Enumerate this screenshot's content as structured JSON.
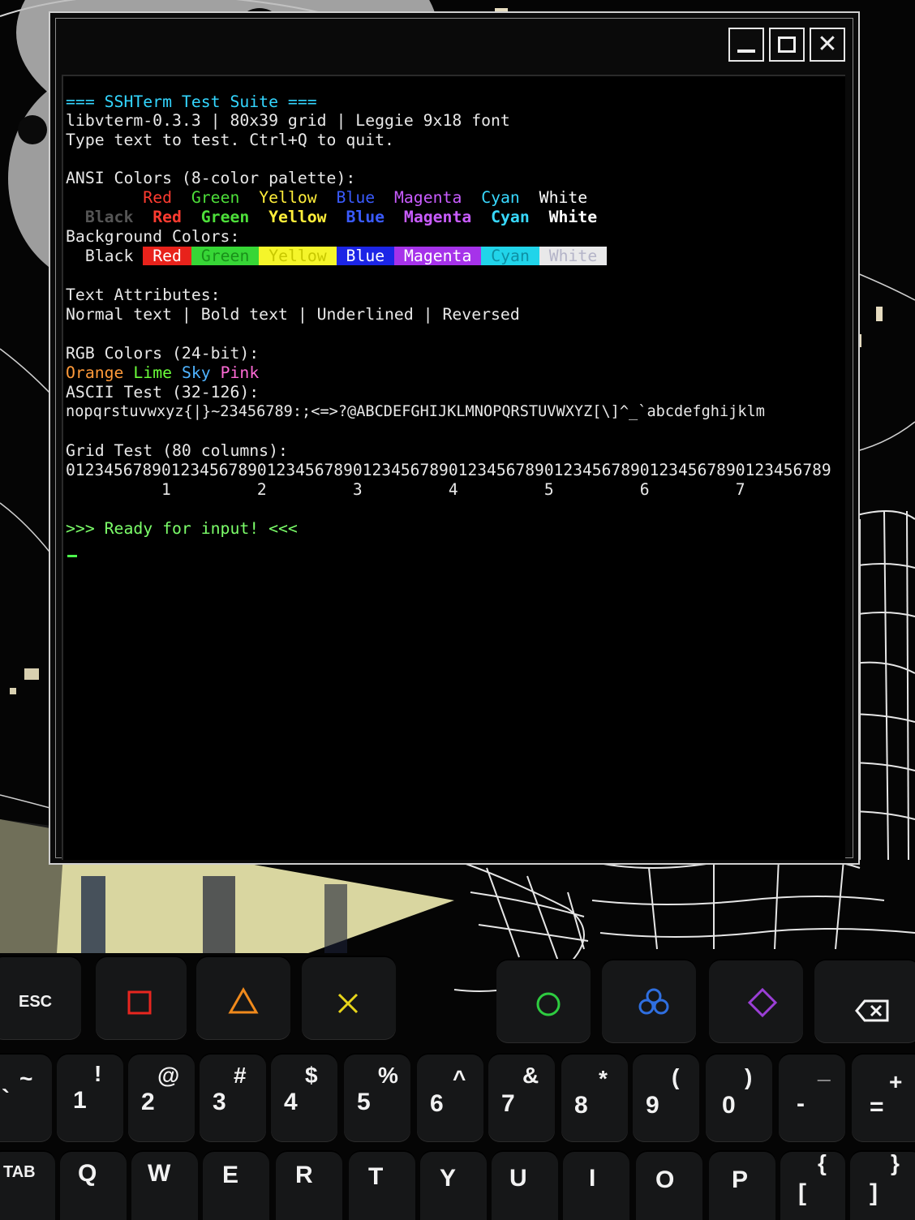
{
  "window": {
    "minimize_label": "_",
    "maximize_label": "□",
    "close_label": "✕"
  },
  "terminal": {
    "lines": {
      "title": "=== SSHTerm Test Suite ===",
      "info": "libvterm-0.3.3 | 80x39 grid | Leggie 9x18 font",
      "instructions": "Type text to test. Ctrl+Q to quit.",
      "ansi_heading": "ANSI Colors (8-color palette):",
      "bg_heading": "Background Colors:",
      "attr_heading": "Text Attributes:",
      "attr_line": "Normal text | Bold text | Underlined | Reversed",
      "rgb_heading": "RGB Colors (24-bit):",
      "ascii_heading": "ASCII Test (32-126):",
      "ascii_line": "nopqrstuvwxyz{|}~23456789:;<=>?@ABCDEFGHIJKLMNOPQRSTUVWXYZ[\\]^_`abcdefghijklm",
      "grid_heading": "Grid Test (80 columns):",
      "grid_digits": "01234567890123456789012345678901234567890123456789012345678901234567890123456789",
      "grid_markers": "          1         2         3         4         5         6         7",
      "ready": ">>> Ready for input! <<<"
    },
    "ansi_row1": [
      "Red",
      "Green",
      "Yellow",
      "Blue",
      "Magenta",
      "Cyan",
      "White"
    ],
    "ansi_row2": [
      "Black",
      "Red",
      "Green",
      "Yellow",
      "Blue",
      "Magenta",
      "Cyan",
      "White"
    ],
    "bg_row": [
      "Black",
      "Red",
      "Green",
      "Yellow",
      "Blue",
      "Magenta",
      "Cyan",
      "White"
    ],
    "rgb_row": [
      "Orange",
      "Lime",
      "Sky",
      "Pink"
    ]
  },
  "keyboard": {
    "row1": [
      "ESC",
      "square",
      "triangle",
      "cross",
      "circle",
      "clover",
      "diamond",
      "backspace"
    ],
    "row2": [
      {
        "main": "`",
        "shift": "~"
      },
      {
        "main": "1",
        "shift": "!"
      },
      {
        "main": "2",
        "shift": "@"
      },
      {
        "main": "3",
        "shift": "#"
      },
      {
        "main": "4",
        "shift": "$"
      },
      {
        "main": "5",
        "shift": "%"
      },
      {
        "main": "6",
        "shift": "^"
      },
      {
        "main": "7",
        "shift": "&"
      },
      {
        "main": "8",
        "shift": "*"
      },
      {
        "main": "9",
        "shift": "("
      },
      {
        "main": "0",
        "shift": ")"
      },
      {
        "main": "-",
        "shift": "_"
      },
      {
        "main": "=",
        "shift": "+"
      }
    ],
    "row3": [
      "TAB",
      "Q",
      "W",
      "E",
      "R",
      "T",
      "Y",
      "U",
      "I",
      "O",
      "P",
      "[",
      "]"
    ],
    "row3_shift": [
      "{",
      "}"
    ]
  },
  "colors": {
    "accent_cyan": "#33d6ff",
    "ready_green": "#7cff6a",
    "square_red": "#e8261f",
    "triangle_orange": "#f08a1c",
    "cross_yellow": "#e8d51a",
    "circle_green": "#2ecc40",
    "clover_blue": "#2f6fe0",
    "diamond_purple": "#9b3fd6"
  }
}
